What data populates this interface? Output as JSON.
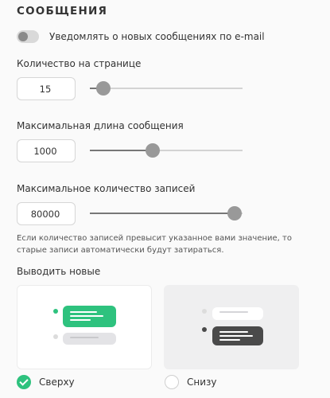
{
  "section": {
    "title": "СООБЩЕНИЯ"
  },
  "notify": {
    "label": "Уведомлять о новых сообщениях по e-mail",
    "enabled": false
  },
  "settings": [
    {
      "label": "Количество на странице",
      "value": "15",
      "slider_level": 0.09
    },
    {
      "label": "Максимальная длина сообщения",
      "value": "1000",
      "slider_level": 0.41
    },
    {
      "label": "Максимальное количество записей",
      "value": "80000",
      "slider_level": 0.95
    }
  ],
  "note": "Если количество записей превысит указанное вами значение, то старые записи автоматически будут затираться.",
  "order": {
    "label": "Выводить новые",
    "options": [
      {
        "label": "Сверху",
        "checked": true
      },
      {
        "label": "Снизу",
        "checked": false
      }
    ]
  },
  "colors": {
    "accent": "#2ec27e",
    "dark_bubble": "#4a4a4a",
    "light_bubble": "#e3e3e6",
    "background": "#fafafa"
  }
}
